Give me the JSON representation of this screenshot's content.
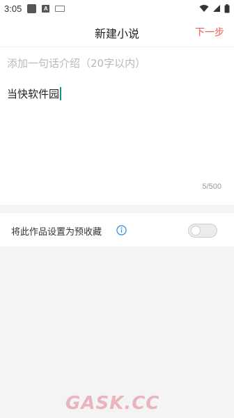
{
  "status_bar": {
    "time": "3:05",
    "icons": [
      "notification-icon",
      "app-a-icon",
      "keyboard-icon",
      "wifi-icon",
      "signal-icon",
      "battery-icon"
    ]
  },
  "header": {
    "title": "新建小说",
    "next_label": "下一步"
  },
  "editor": {
    "intro_placeholder": "添加一句话介绍（20字以内）",
    "title_value": "当快软件园",
    "char_count": "5/500"
  },
  "preorder": {
    "label": "将此作品设置为预收藏",
    "toggle_on": false
  },
  "watermark": {
    "text": "GASK.CC"
  },
  "colors": {
    "accent": "#f05a4d",
    "info_blue": "#3d8ee8",
    "cursor": "#1e8e8e",
    "background": "#f4f4f4"
  }
}
